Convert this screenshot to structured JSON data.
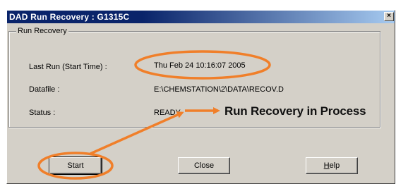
{
  "window": {
    "title": "DAD Run Recovery : G1315C",
    "close_glyph": "×"
  },
  "group": {
    "legend": "Run Recovery"
  },
  "fields": {
    "last_run_label": "Last Run (Start Time) :",
    "last_run_value": "Thu Feb 24 10:16:07 2005",
    "datafile_label": "Datafile :",
    "datafile_value": "E:\\CHEMSTATION\\2\\DATA\\RECOV.D",
    "status_label": "Status :",
    "status_value": "READY"
  },
  "buttons": {
    "start": "Start",
    "close": "Close",
    "help_mnemonic": "H",
    "help_rest": "elp"
  },
  "annotation": {
    "text": "Run Recovery in Process",
    "color": "#f07f2a"
  }
}
